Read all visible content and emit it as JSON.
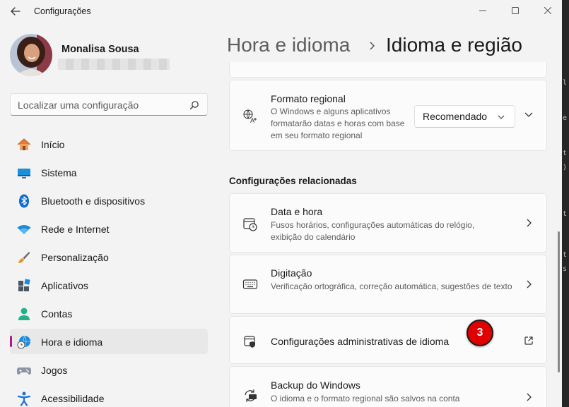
{
  "window": {
    "title": "Configurações"
  },
  "user": {
    "name": "Monalisa Sousa"
  },
  "search": {
    "placeholder": "Localizar uma configuração"
  },
  "nav": {
    "items": [
      {
        "label": "Início",
        "icon": "home-icon"
      },
      {
        "label": "Sistema",
        "icon": "monitor-icon"
      },
      {
        "label": "Bluetooth e dispositivos",
        "icon": "bluetooth-icon"
      },
      {
        "label": "Rede e Internet",
        "icon": "wifi-icon"
      },
      {
        "label": "Personalização",
        "icon": "brush-icon"
      },
      {
        "label": "Aplicativos",
        "icon": "apps-icon"
      },
      {
        "label": "Contas",
        "icon": "person-icon"
      },
      {
        "label": "Hora e idioma",
        "icon": "clock-globe-icon",
        "selected": true
      },
      {
        "label": "Jogos",
        "icon": "gamepad-icon"
      },
      {
        "label": "Acessibilidade",
        "icon": "accessibility-icon"
      }
    ]
  },
  "breadcrumb": {
    "parent": "Hora e idioma",
    "current": "Idioma e região"
  },
  "regional_format": {
    "title": "Formato regional",
    "description": "O Windows e alguns aplicativos formatarão datas e horas com base em seu formato regional",
    "dropdown_value": "Recomendado"
  },
  "related": {
    "heading": "Configurações relacionadas",
    "items": [
      {
        "title": "Data e hora",
        "description": "Fusos horários, configurações automáticas do relógio, exibição do calendário",
        "icon": "calendar-clock-icon"
      },
      {
        "title": "Digitação",
        "description": "Verificação ortográfica, correção automática, sugestões de texto",
        "icon": "keyboard-icon"
      },
      {
        "title": "Configurações administrativas de idioma",
        "description": "",
        "icon": "shield-icon"
      },
      {
        "title": "Backup do Windows",
        "description": "O idioma e o formato regional são salvos na conta",
        "icon": "backup-sync-icon"
      }
    ]
  },
  "annotation": {
    "badge_number": "3"
  },
  "colors": {
    "accent": "#0067c0",
    "nav_indicator": "#b0198a",
    "badge": "#e00000",
    "background": "#f3f3f3",
    "card": "#fbfbfb"
  }
}
